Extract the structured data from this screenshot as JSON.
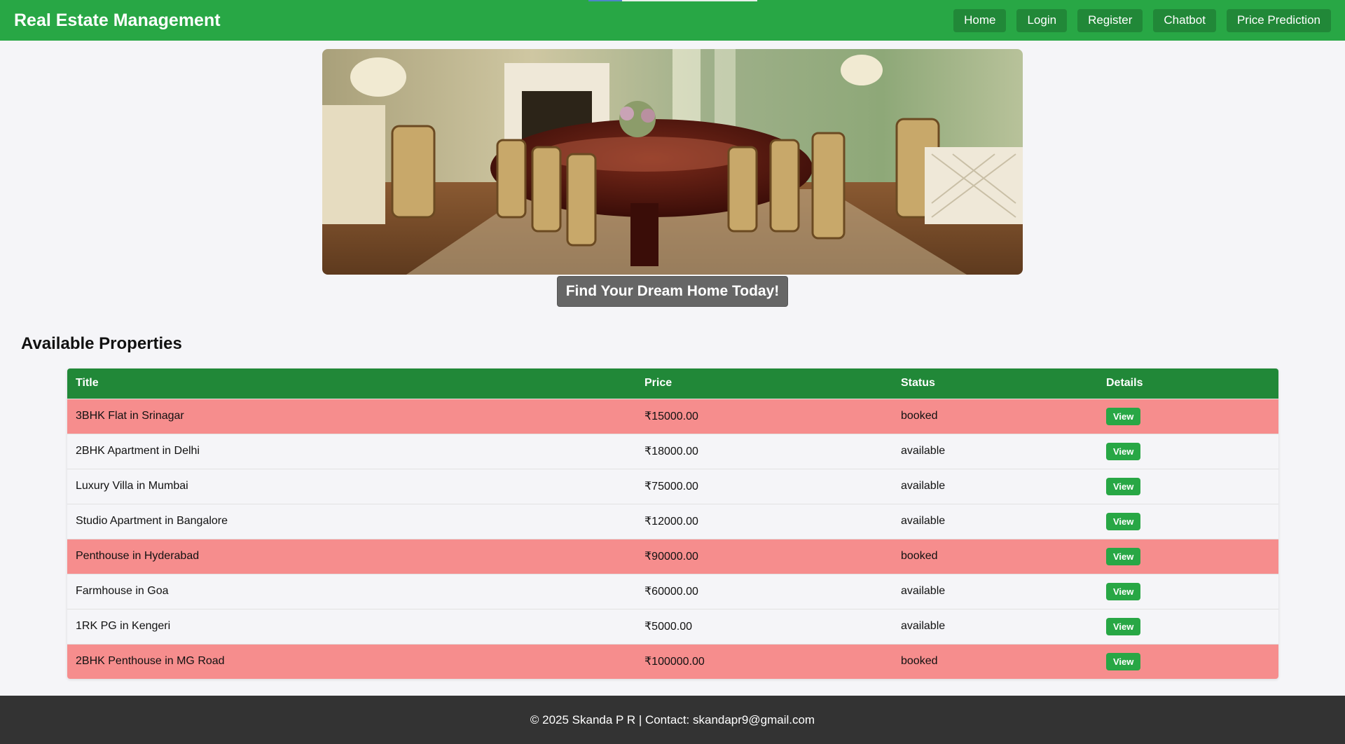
{
  "header": {
    "brand": "Real Estate Management",
    "nav": [
      "Home",
      "Login",
      "Register",
      "Chatbot",
      "Price Prediction"
    ]
  },
  "hero": {
    "cta_label": "Find Your Dream Home Today!"
  },
  "properties": {
    "title": "Available Properties",
    "columns": [
      "Title",
      "Price",
      "Status",
      "Details"
    ],
    "rows": [
      {
        "title": "3BHK Flat in Srinagar",
        "price": "₹15000.00",
        "status": "booked",
        "action": "View"
      },
      {
        "title": "2BHK Apartment in Delhi",
        "price": "₹18000.00",
        "status": "available",
        "action": "View"
      },
      {
        "title": "Luxury Villa in Mumbai",
        "price": "₹75000.00",
        "status": "available",
        "action": "View"
      },
      {
        "title": "Studio Apartment in Bangalore",
        "price": "₹12000.00",
        "status": "available",
        "action": "View"
      },
      {
        "title": "Penthouse in Hyderabad",
        "price": "₹90000.00",
        "status": "booked",
        "action": "View"
      },
      {
        "title": "Farmhouse in Goa",
        "price": "₹60000.00",
        "status": "available",
        "action": "View"
      },
      {
        "title": "1RK PG in Kengeri",
        "price": "₹5000.00",
        "status": "available",
        "action": "View"
      },
      {
        "title": "2BHK Penthouse in MG Road",
        "price": "₹100000.00",
        "status": "booked",
        "action": "View"
      }
    ]
  },
  "footer": {
    "text": "© 2025 Skanda P R | Contact: skandapr9@gmail.com"
  },
  "colors": {
    "primary": "#28a745",
    "primary_dark": "#218838",
    "booked_row": "#f68d8d",
    "footer_bg": "#333333"
  }
}
